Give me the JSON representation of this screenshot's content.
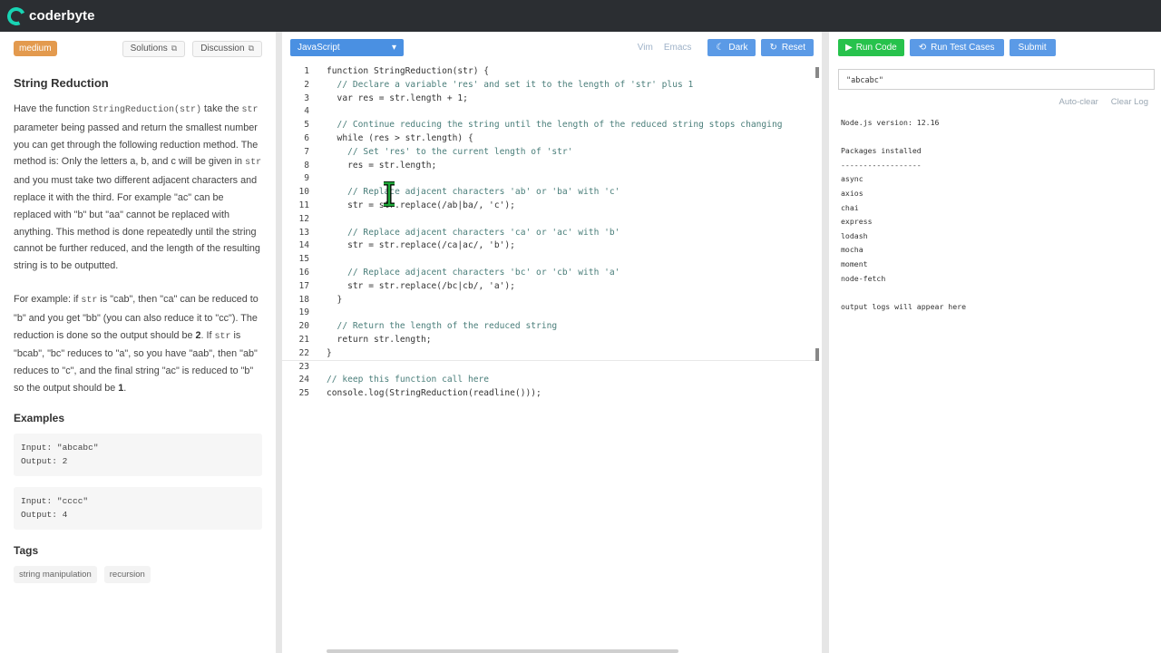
{
  "brand": {
    "name": "coderbyte"
  },
  "problem": {
    "difficulty": "medium",
    "solutions_label": "Solutions",
    "discussion_label": "Discussion",
    "title": "String Reduction",
    "desc": {
      "p1_a": "Have the function ",
      "p1_fn": "StringReduction(str)",
      "p1_b": " take the ",
      "p1_str": "str",
      "p1_c": " parameter being passed and return the smallest number you can get through the following reduction method. The method is: Only the letters a, b, and c will be given in ",
      "p1_str2": "str",
      "p1_d": " and you must take two different adjacent characters and replace it with the third. For example \"ac\" can be replaced with \"b\" but \"aa\" cannot be replaced with anything. This method is done repeatedly until the string cannot be further reduced, and the length of the resulting string is to be outputted.",
      "p2_a": "For example: if ",
      "p2_str": "str",
      "p2_b": " is \"cab\", then \"ca\" can be reduced to \"b\" and you get \"bb\" (you can also reduce it to \"cc\"). The reduction is done so the output should be ",
      "p2_num": "2",
      "p2_c": ". If ",
      "p2_str2": "str",
      "p2_d": " is \"bcab\", \"bc\" reduces to \"a\", so you have \"aab\", then \"ab\" reduces to \"c\", and the final string \"ac\" is reduced to \"b\" so the output should be ",
      "p2_num2": "1",
      "p2_e": "."
    },
    "examples_title": "Examples",
    "examples": [
      {
        "input": "Input: \"abcabc\"",
        "output": "Output: 2"
      },
      {
        "input": "Input: \"cccc\"",
        "output": "Output: 4"
      }
    ],
    "tags_title": "Tags",
    "tags": [
      "string manipulation",
      "recursion"
    ]
  },
  "editor": {
    "language": "JavaScript",
    "vim_label": "Vim",
    "emacs_label": "Emacs",
    "dark_label": "Dark",
    "reset_label": "Reset",
    "lines": [
      "function StringReduction(str) {",
      "  // Declare a variable 'res' and set it to the length of 'str' plus 1",
      "  var res = str.length + 1;",
      "",
      "  // Continue reducing the string until the length of the reduced string stops changing",
      "  while (res > str.length) {",
      "    // Set 'res' to the current length of 'str'",
      "    res = str.length;",
      "",
      "    // Replace adjacent characters 'ab' or 'ba' with 'c'",
      "    str = str.replace(/ab|ba/, 'c');",
      "",
      "    // Replace adjacent characters 'ca' or 'ac' with 'b'",
      "    str = str.replace(/ca|ac/, 'b');",
      "",
      "    // Replace adjacent characters 'bc' or 'cb' with 'a'",
      "    str = str.replace(/bc|cb/, 'a');",
      "  }",
      "",
      "  // Return the length of the reduced string",
      "  return str.length;",
      "}",
      "",
      "// keep this function call here",
      "console.log(StringReduction(readline()));"
    ]
  },
  "runner": {
    "run_label": "Run Code",
    "test_label": "Run Test Cases",
    "submit_label": "Submit",
    "input_value": "\"abcabc\"",
    "autoclear_label": "Auto-clear",
    "clearlog_label": "Clear Log",
    "console": {
      "version": "Node.js version: 12.16",
      "packages_title": "Packages installed",
      "rule": "------------------",
      "packages": [
        "async",
        "axios",
        "chai",
        "express",
        "lodash",
        "mocha",
        "moment",
        "node-fetch"
      ],
      "placeholder": "output logs will appear here"
    }
  },
  "colors": {
    "topbar": "#2b2e32",
    "accent_blue": "#5b9ae6",
    "run_green": "#27c24c",
    "difficulty": "#e39a4e"
  }
}
